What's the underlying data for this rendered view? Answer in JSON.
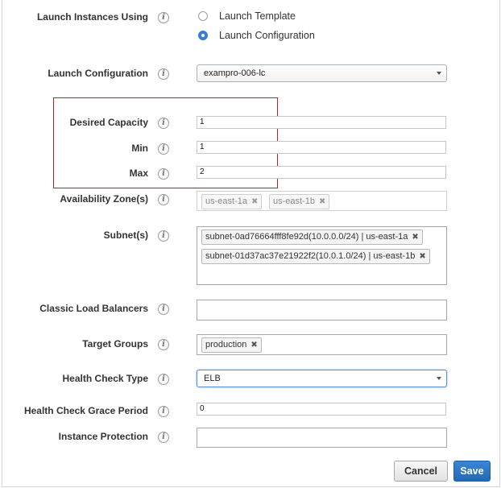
{
  "launch_using": {
    "label": "Launch Instances Using",
    "options": [
      {
        "label": "Launch Template",
        "checked": false
      },
      {
        "label": "Launch Configuration",
        "checked": true
      }
    ]
  },
  "launch_configuration": {
    "label": "Launch Configuration",
    "value": "exampro-006-lc"
  },
  "desired_capacity": {
    "label": "Desired Capacity",
    "value": "1"
  },
  "min": {
    "label": "Min",
    "value": "1"
  },
  "max": {
    "label": "Max",
    "value": "2"
  },
  "availability_zones": {
    "label": "Availability Zone(s)",
    "tags": [
      "us-east-1a",
      "us-east-1b"
    ]
  },
  "subnets": {
    "label": "Subnet(s)",
    "tags": [
      "subnet-0ad76664fff8fe92d(10.0.0.0/24) | us-east-1a",
      "subnet-01d37ac37e21922f2(10.0.1.0/24) | us-east-1b"
    ]
  },
  "classic_load_balancers": {
    "label": "Classic Load Balancers",
    "value": ""
  },
  "target_groups": {
    "label": "Target Groups",
    "tags": [
      "production"
    ]
  },
  "health_check_type": {
    "label": "Health Check Type",
    "value": "ELB"
  },
  "health_check_grace_period": {
    "label": "Health Check Grace Period",
    "value": "0"
  },
  "instance_protection": {
    "label": "Instance Protection",
    "value": ""
  },
  "info_icon_glyph": "i",
  "tag_remove_glyph": "✖",
  "buttons": {
    "cancel": "Cancel",
    "save": "Save"
  },
  "colors": {
    "primary": "#2a70bf",
    "highlight_border": "#b1242b",
    "radio_selected": "#3b7dd8"
  }
}
